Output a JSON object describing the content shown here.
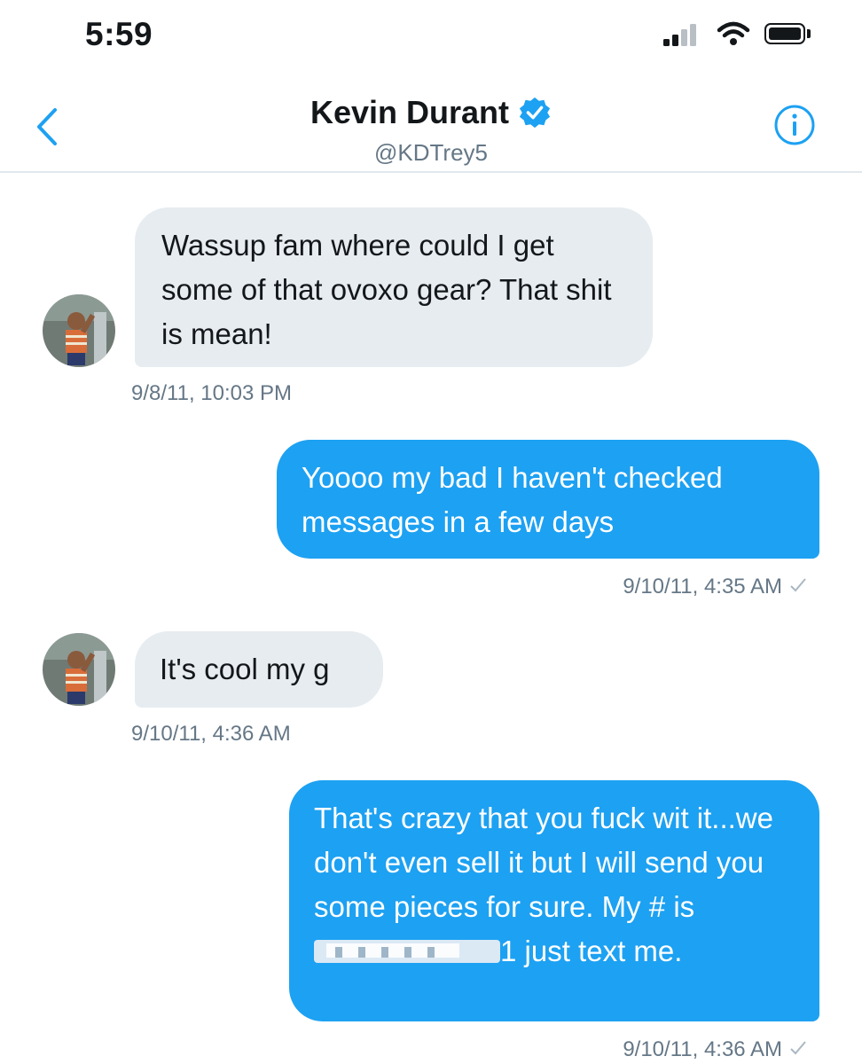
{
  "status_bar": {
    "time": "5:59"
  },
  "header": {
    "name": "Kevin Durant",
    "handle": "@KDTrey5"
  },
  "messages": [
    {
      "direction": "incoming",
      "text": "Wassup fam where could I get some of that ovoxo gear? That shit is mean!",
      "time": "9/8/11, 10:03 PM"
    },
    {
      "direction": "outgoing",
      "text": "Yoooo my bad I haven't checked messages in a few days",
      "time": "9/10/11, 4:35 AM"
    },
    {
      "direction": "incoming",
      "text": "It's cool my g",
      "time": "9/10/11, 4:36 AM"
    },
    {
      "direction": "outgoing",
      "text_before": "That's crazy that you fuck wit it...we don't even sell it but I will send you some pieces for sure. My # is ",
      "text_after": "1 just text me.",
      "time": "9/10/11, 4:36 AM"
    }
  ],
  "colors": {
    "accent": "#1da1f2",
    "incoming_bubble": "#e6ecf0",
    "timestamp": "#657786"
  },
  "icons": [
    "back-chevron-icon",
    "verified-badge-icon",
    "info-icon",
    "signal-icon",
    "wifi-icon",
    "battery-icon",
    "read-check-icon"
  ]
}
